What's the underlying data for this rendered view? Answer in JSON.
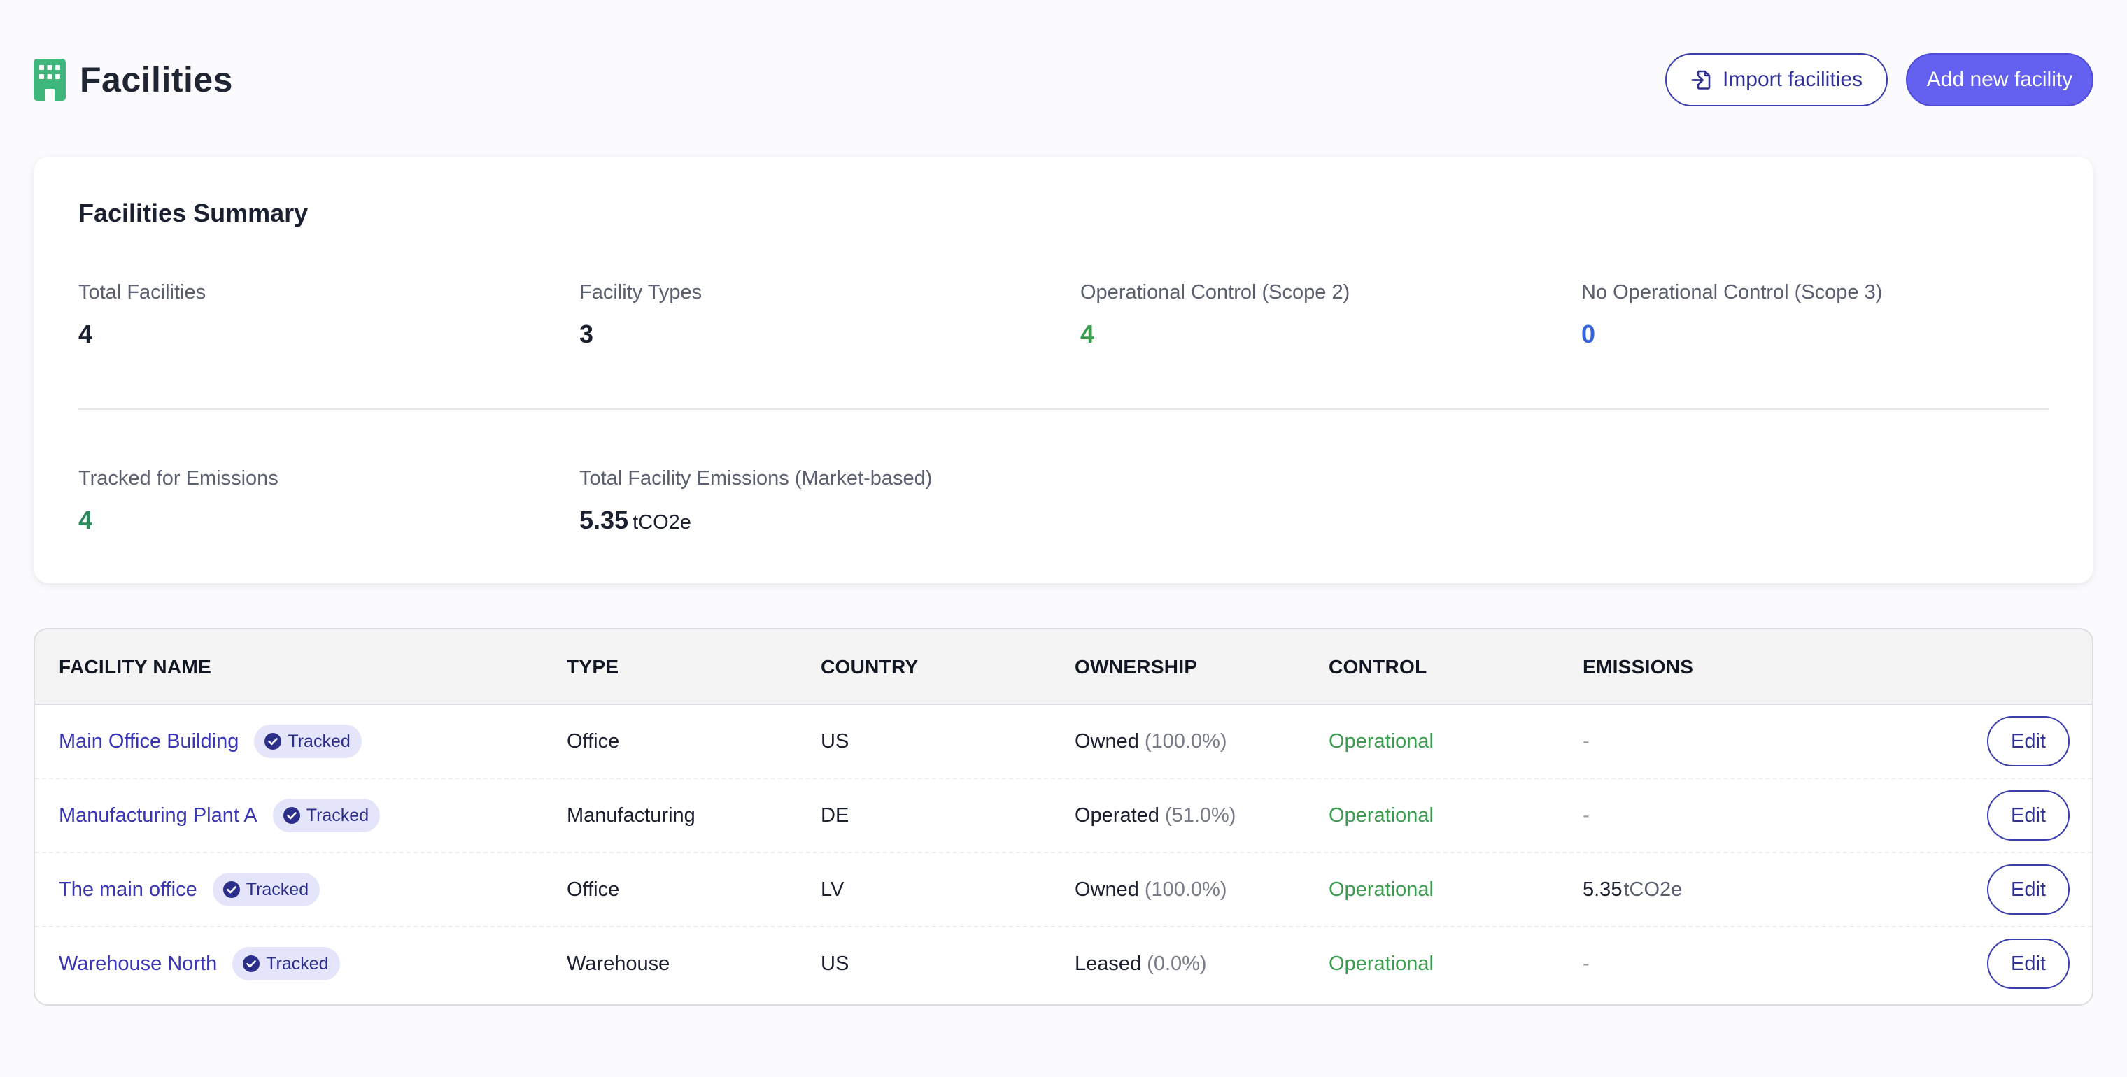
{
  "header": {
    "title": "Facilities",
    "import_label": "Import facilities",
    "add_label": "Add new facility",
    "icon": "building-icon",
    "import_icon": "file-import-icon"
  },
  "summary": {
    "title": "Facilities Summary",
    "total_facilities": {
      "label": "Total Facilities",
      "value": "4"
    },
    "facility_types": {
      "label": "Facility Types",
      "value": "3"
    },
    "operational_control": {
      "label": "Operational Control (Scope 2)",
      "value": "4"
    },
    "no_operational_control": {
      "label": "No Operational Control (Scope 3)",
      "value": "0"
    },
    "tracked": {
      "label": "Tracked for Emissions",
      "value": "4"
    },
    "total_emissions": {
      "label": "Total Facility Emissions (Market-based)",
      "value": "5.35",
      "unit": "tCO2e"
    }
  },
  "table": {
    "columns": [
      "FACILITY NAME",
      "TYPE",
      "COUNTRY",
      "OWNERSHIP",
      "CONTROL",
      "EMISSIONS"
    ],
    "edit_label": "Edit",
    "rows": [
      {
        "name": "Main Office Building",
        "badge": "Tracked",
        "type": "Office",
        "country": "US",
        "ownership": "Owned",
        "ownership_pct": "(100.0%)",
        "control": "Operational",
        "emissions": "-",
        "emissions_unit": ""
      },
      {
        "name": "Manufacturing Plant A",
        "badge": "Tracked",
        "type": "Manufacturing",
        "country": "DE",
        "ownership": "Operated",
        "ownership_pct": "(51.0%)",
        "control": "Operational",
        "emissions": "-",
        "emissions_unit": ""
      },
      {
        "name": "The main office",
        "badge": "Tracked",
        "type": "Office",
        "country": "LV",
        "ownership": "Owned",
        "ownership_pct": "(100.0%)",
        "control": "Operational",
        "emissions": "5.35",
        "emissions_unit": "tCO2e"
      },
      {
        "name": "Warehouse North",
        "badge": "Tracked",
        "type": "Warehouse",
        "country": "US",
        "ownership": "Leased",
        "ownership_pct": "(0.0%)",
        "control": "Operational",
        "emissions": "-",
        "emissions_unit": ""
      }
    ]
  },
  "colors": {
    "brand_green": "#3fb67b",
    "primary": "#6461f0",
    "link": "#3935b5",
    "operational": "#3b9c4f",
    "scope3_blue": "#3563d9"
  }
}
